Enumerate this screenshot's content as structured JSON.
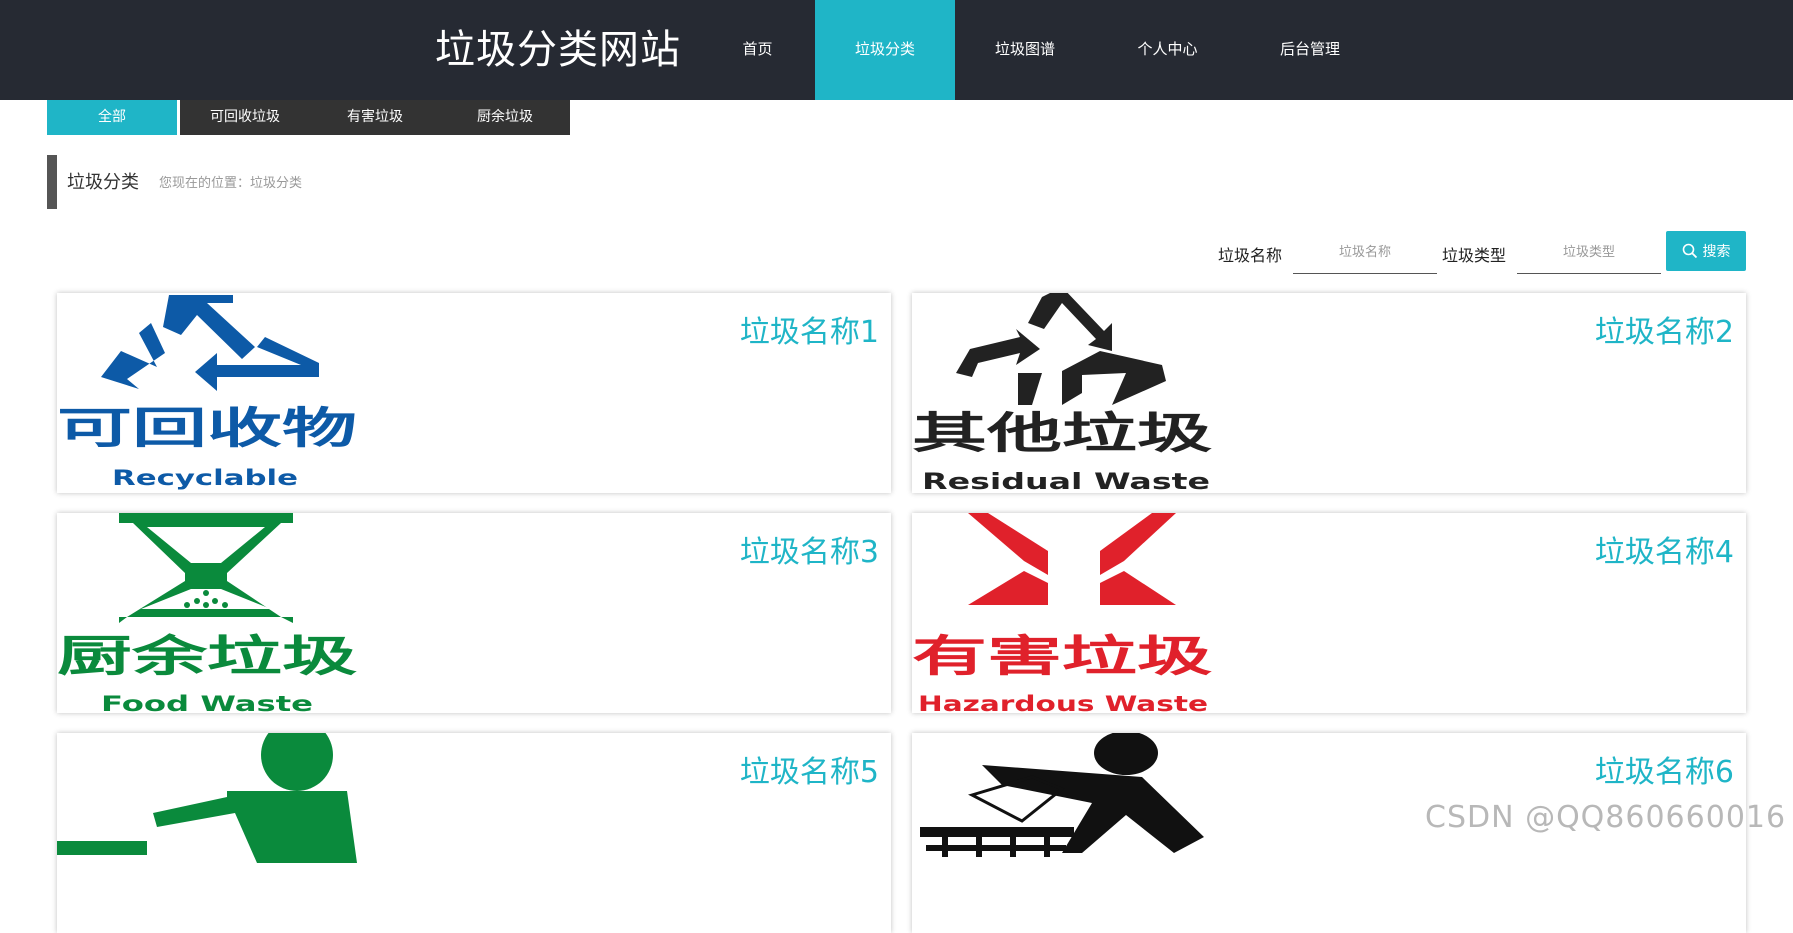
{
  "header": {
    "site_title": "垃圾分类网站",
    "nav": [
      {
        "label": "首页",
        "active": false
      },
      {
        "label": "垃圾分类",
        "active": true
      },
      {
        "label": "垃圾图谱",
        "active": false
      },
      {
        "label": "个人中心",
        "active": false
      },
      {
        "label": "后台管理",
        "active": false
      }
    ]
  },
  "subtabs": [
    {
      "label": "全部",
      "active": true
    },
    {
      "label": "可回收垃圾",
      "active": false
    },
    {
      "label": "有害垃圾",
      "active": false
    },
    {
      "label": "厨余垃圾",
      "active": false
    }
  ],
  "section": {
    "title": "垃圾分类",
    "breadcrumb": "您现在的位置：垃圾分类"
  },
  "search": {
    "name_label": "垃圾名称",
    "name_placeholder": "垃圾名称",
    "type_label": "垃圾类型",
    "type_placeholder": "垃圾类型",
    "button_label": "搜索"
  },
  "cards": [
    {
      "name": "垃圾名称1",
      "sign_cn": "可回收物",
      "sign_en": "Recyclable",
      "color": "#0d5aa7"
    },
    {
      "name": "垃圾名称2",
      "sign_cn": "其他垃圾",
      "sign_en": "Residual Waste",
      "color": "#222222"
    },
    {
      "name": "垃圾名称3",
      "sign_cn": "厨余垃圾",
      "sign_en": "Food Waste",
      "color": "#0a8a3c"
    },
    {
      "name": "垃圾名称4",
      "sign_cn": "有害垃圾",
      "sign_en": "Hazardous Waste",
      "color": "#e0212b"
    },
    {
      "name": "垃圾名称5",
      "color": "#0a8a3c"
    },
    {
      "name": "垃圾名称6",
      "color": "#111111"
    }
  ],
  "watermark": "CSDN @QQ860660016",
  "colors": {
    "accent": "#1fb5c7",
    "header_bg": "#262a33"
  }
}
